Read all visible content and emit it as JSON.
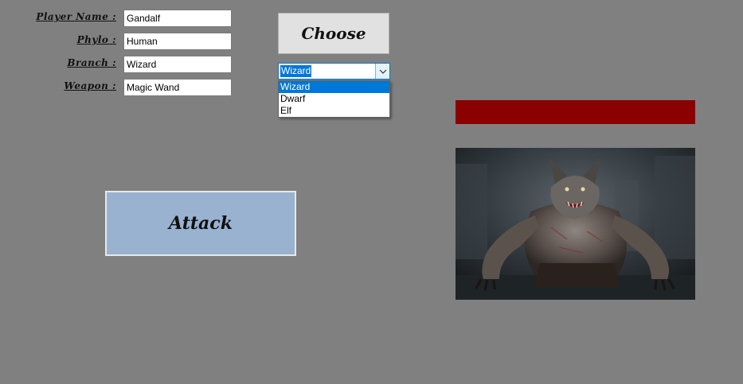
{
  "form": {
    "player_name_label": "Player Name :",
    "player_name_value": "Gandalf",
    "phylo_label": "Phylo :",
    "phylo_value": "Human",
    "branch_label": "Branch :",
    "branch_value": "Wizard",
    "weapon_label": "Weapon :",
    "weapon_value": "Magic Wand"
  },
  "choose_button": {
    "label": "Choose"
  },
  "class_select": {
    "selected": "Wizard",
    "options": [
      "Wizard",
      "Dwarf",
      "Elf"
    ]
  },
  "attack_button": {
    "label": "Attack"
  },
  "enemy": {
    "health_fraction": 1.0,
    "health_color": "#8b0000",
    "image_subject": "werewolf"
  },
  "colors": {
    "background": "#808080",
    "attack_button": "#98b2d0",
    "selection": "#0078d7"
  }
}
